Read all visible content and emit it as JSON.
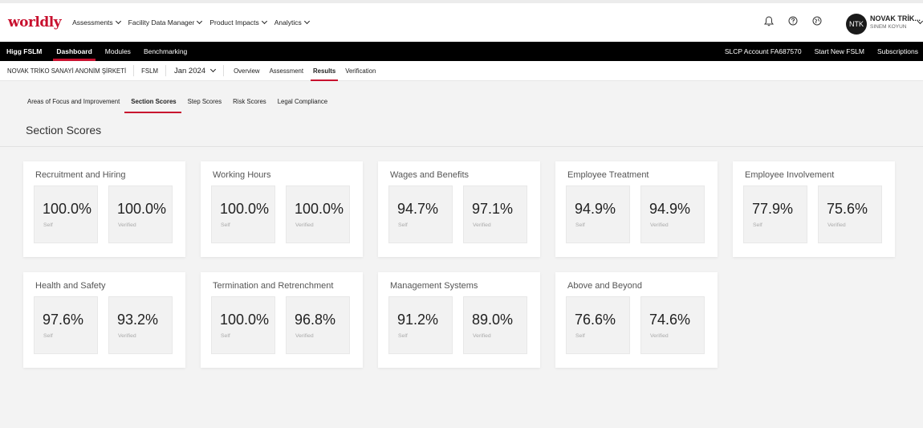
{
  "header": {
    "logo": "worldly",
    "nav": [
      {
        "label": "Assessments"
      },
      {
        "label": "Facility Data Manager"
      },
      {
        "label": "Product Impacts"
      },
      {
        "label": "Analytics"
      }
    ],
    "icons": [
      "bell-icon",
      "help-icon",
      "globe-icon"
    ],
    "avatar_initials": "NTK",
    "user_name": "NOVAK TRİK...",
    "user_sub": "SINEM KOYUN"
  },
  "module_bar": {
    "brand": "Higg FSLM",
    "items": [
      {
        "label": "Dashboard",
        "active": true
      },
      {
        "label": "Modules",
        "active": false
      },
      {
        "label": "Benchmarking",
        "active": false
      }
    ],
    "right": [
      {
        "label": "SLCP Account FA687570"
      },
      {
        "label": "Start New FSLM"
      },
      {
        "label": "Subscriptions"
      }
    ]
  },
  "facility_bar": {
    "name": "NOVAK TRİKO SANAYİ ANONİM ŞİRKETİ",
    "module": "FSLM",
    "period": "Jan 2024",
    "tabs": [
      {
        "label": "Overview",
        "active": false
      },
      {
        "label": "Assessment",
        "active": false
      },
      {
        "label": "Results",
        "active": true
      },
      {
        "label": "Verification",
        "active": false
      }
    ]
  },
  "sub_tabs": [
    {
      "label": "Areas of Focus and Improvement",
      "active": false
    },
    {
      "label": "Section Scores",
      "active": true
    },
    {
      "label": "Step Scores",
      "active": false
    },
    {
      "label": "Risk Scores",
      "active": false
    },
    {
      "label": "Legal Compliance",
      "active": false
    }
  ],
  "page_title": "Section Scores",
  "score_labels": {
    "self": "Self",
    "verified": "Verified"
  },
  "sections": [
    {
      "title": "Recruitment and Hiring",
      "self": "100.0%",
      "verified": "100.0%"
    },
    {
      "title": "Working Hours",
      "self": "100.0%",
      "verified": "100.0%"
    },
    {
      "title": "Wages and Benefits",
      "self": "94.7%",
      "verified": "97.1%"
    },
    {
      "title": "Employee Treatment",
      "self": "94.9%",
      "verified": "94.9%"
    },
    {
      "title": "Employee Involvement",
      "self": "77.9%",
      "verified": "75.6%"
    },
    {
      "title": "Health and Safety",
      "self": "97.6%",
      "verified": "93.2%"
    },
    {
      "title": "Termination and Retrenchment",
      "self": "100.0%",
      "verified": "96.8%"
    },
    {
      "title": "Management Systems",
      "self": "91.2%",
      "verified": "89.0%"
    },
    {
      "title": "Above and Beyond",
      "self": "76.6%",
      "verified": "74.6%"
    }
  ],
  "colors": {
    "accent": "#c8102e",
    "module_bar": "#000000",
    "background": "#f3f3f3"
  }
}
